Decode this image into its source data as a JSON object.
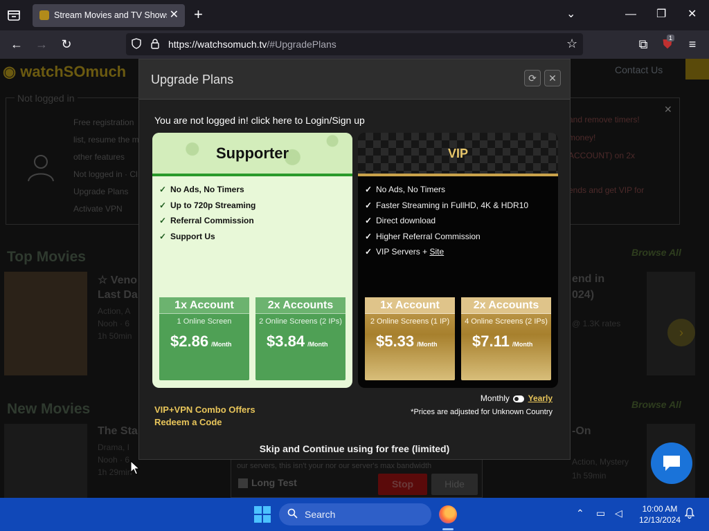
{
  "browser": {
    "tab_title": "Stream Movies and TV Shows F",
    "tab_close": "✕",
    "new_tab": "+",
    "url_host": "https://watchsomuch.tv",
    "url_path": "/#UpgradePlans",
    "extension_badge": "1",
    "window_controls": {
      "minimize": "—",
      "maximize": "❐",
      "close": "✕"
    }
  },
  "background_page": {
    "header_right": "Contact Us",
    "login_box": {
      "label": "Not logged in",
      "lines": [
        "Free registration",
        "list, resume the m",
        "other features",
        "Not logged in · Cl",
        "Upgrade Plans",
        "Activate VPN"
      ],
      "right_lines": [
        "and remove timers!",
        "money!",
        "ACCOUNT) on 2x",
        "ends and get VIP for"
      ]
    },
    "top_movies": "Top Movies",
    "new_movies": "New Movies",
    "browse_all": "Browse All",
    "movies": [
      {
        "title": "☆ Veno",
        "title2": "Last Da",
        "sub": "Action, A",
        "sub2": "Nooh · 6",
        "sub3": "1h 50min"
      },
      {
        "title": "end in",
        "title2": "024)",
        "sub": "@ 1.3K rates",
        "sub2": ""
      },
      {
        "title": "The Sta",
        "sub": "Drama, I",
        "sub2": "Nooh · 6",
        "sub3": "1h 29min"
      },
      {
        "title": "-On",
        "sub": "Action, Mystery",
        "sub2": "1h 59min"
      }
    ],
    "test_panel": {
      "note": "our servers, this isn't your nor our server's max bandwidth",
      "long_test": "Long Test",
      "stop": "Stop",
      "hide": "Hide"
    }
  },
  "modal": {
    "title": "Upgrade Plans",
    "not_logged": "You are not logged in! click here to Login/Sign up",
    "plans": [
      {
        "name": "Supporter",
        "features": [
          "No Ads, No Timers",
          "Up to 720p Streaming",
          "Referral Commission",
          "Support Us"
        ],
        "prices": [
          {
            "title": "1x Account",
            "screens": "1 Online Screen",
            "amount": "$2.86",
            "period": "/Month"
          },
          {
            "title": "2x Accounts",
            "screens": "2 Online Screens (2 IPs)",
            "amount": "$3.84",
            "period": "/Month"
          }
        ]
      },
      {
        "name": "VIP",
        "features": [
          "No Ads, No Timers",
          "Faster Streaming in FullHD, 4K & HDR10",
          "Direct download",
          "Higher Referral Commission",
          "VIP Servers + "
        ],
        "site_link": "Site",
        "prices": [
          {
            "title": "1x Account",
            "screens": "2 Online Screens (1 IP)",
            "amount": "$5.33",
            "period": "/Month"
          },
          {
            "title": "2x Accounts",
            "screens": "4 Online Screens (2 IPs)",
            "amount": "$7.11",
            "period": "/Month"
          }
        ]
      }
    ],
    "billing_monthly": "Monthly",
    "billing_yearly": "Yearly",
    "prices_note": "*Prices are adjusted for Unknown Country",
    "combo_offers": "VIP+VPN Combo Offers",
    "redeem_code": "Redeem a Code",
    "skip": "Skip and Continue using for free (limited)"
  },
  "taskbar": {
    "search": "Search",
    "time": "10:00 AM",
    "date": "12/13/2024"
  },
  "colors": {
    "accent_gold": "#e8c55a",
    "supporter_green": "#4fa055",
    "vip_gold": "#c6a257",
    "taskbar_blue": "#1048b8"
  }
}
